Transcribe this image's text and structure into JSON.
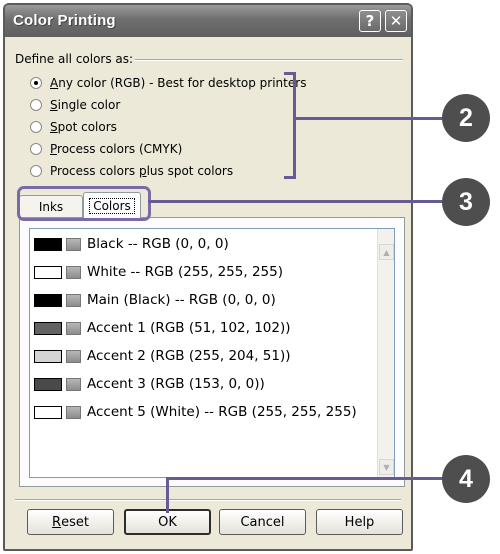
{
  "dialog": {
    "title": "Color Printing",
    "help_glyph": "?",
    "close_glyph": "✕"
  },
  "group_label": "Define all colors as:",
  "radio_options": [
    {
      "pre": "",
      "u": "A",
      "post": "ny color (RGB) - Best for desktop printers",
      "checked": true
    },
    {
      "pre": "",
      "u": "S",
      "post": "ingle color",
      "checked": false
    },
    {
      "pre": "",
      "u": "S",
      "post": "pot colors",
      "checked": false
    },
    {
      "pre": "",
      "u": "P",
      "post": "rocess colors (CMYK)",
      "checked": false
    },
    {
      "pre": "Process colors ",
      "u": "p",
      "post": "lus spot colors",
      "checked": false
    }
  ],
  "tabs": [
    {
      "label": "Inks",
      "selected": false
    },
    {
      "label": "Colors",
      "selected": true
    }
  ],
  "color_list": [
    {
      "color": "#000000",
      "label": "Black  --  RGB (0, 0, 0)"
    },
    {
      "color": "#ffffff",
      "label": "White  --  RGB (255, 255, 255)"
    },
    {
      "color": "#000000",
      "label": "Main (Black)  --  RGB (0, 0, 0)"
    },
    {
      "color": "#636363",
      "label": "Accent 1 (RGB (51, 102, 102))"
    },
    {
      "color": "#d4d4d4",
      "label": "Accent 2 (RGB (255, 204, 51))"
    },
    {
      "color": "#4a4a4a",
      "label": "Accent 3 (RGB (153, 0, 0))"
    },
    {
      "color": "#ffffff",
      "label": "Accent 5 (White)  --  RGB (255, 255, 255)"
    }
  ],
  "buttons": {
    "reset": {
      "u": "R",
      "post": "eset"
    },
    "ok": "OK",
    "cancel": "Cancel",
    "help": "Help"
  },
  "callouts": [
    "2",
    "3",
    "4"
  ],
  "scroll_icons": {
    "up": "up-arrow-icon",
    "down": "down-arrow-icon"
  }
}
